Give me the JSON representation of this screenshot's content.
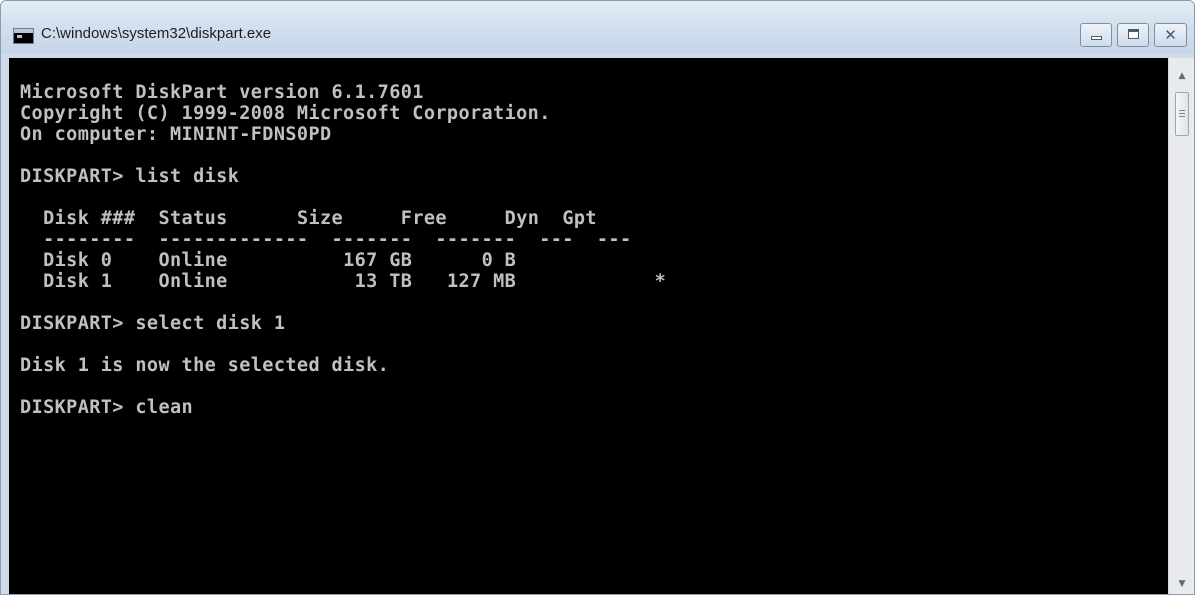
{
  "window": {
    "title": "C:\\windows\\system32\\diskpart.exe",
    "icon": "console-icon",
    "controls": {
      "minimize": "minimize-icon",
      "maximize": "maximize-icon",
      "close": "close-icon",
      "close_glyph": "✕"
    }
  },
  "console": {
    "banner": [
      "Microsoft DiskPart version 6.1.7601",
      "Copyright (C) 1999-2008 Microsoft Corporation.",
      "On computer: MININT-FDNS0PD"
    ],
    "prompt": "DISKPART> ",
    "commands": {
      "list": "list disk",
      "select": "select disk 1",
      "clean": "clean"
    },
    "disk_table": {
      "headers": [
        "Disk ###",
        "Status",
        "Size",
        "Free",
        "Dyn",
        "Gpt"
      ],
      "rows": [
        {
          "disk": "Disk 0",
          "status": "Online",
          "size": "167 GB",
          "free": "0 B",
          "dyn": "",
          "gpt": ""
        },
        {
          "disk": "Disk 1",
          "status": "Online",
          "size": "13 TB",
          "free": "127 MB",
          "dyn": "",
          "gpt": "*"
        }
      ]
    },
    "select_result": "Disk 1 is now the selected disk.",
    "text_color": "#c0c0c0",
    "background_color": "#000000"
  },
  "scrollbar": {
    "up_arrow": "▲",
    "down_arrow": "▼"
  }
}
